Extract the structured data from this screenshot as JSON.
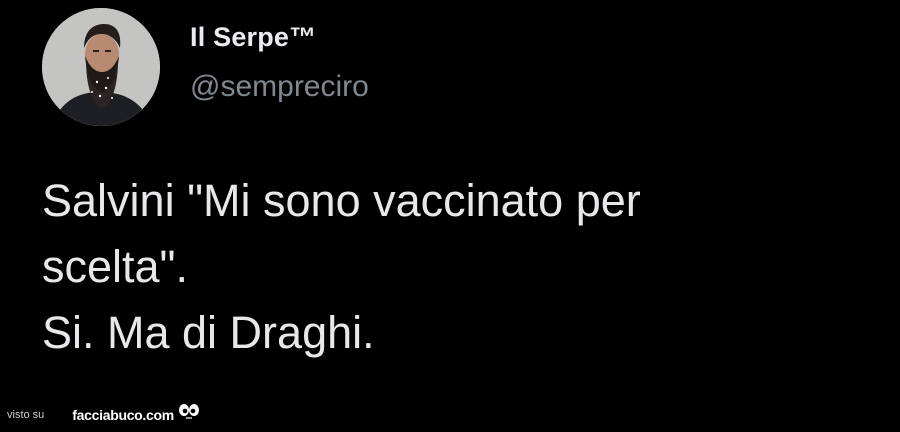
{
  "tweet": {
    "display_name": "Il Serpe™",
    "handle": "@sempreciro",
    "avatar_icon": "bearded-man-avatar",
    "lines": [
      "Salvini \"Mi sono vaccinato per",
      "scelta\".",
      "Si. Ma di Draghi."
    ]
  },
  "watermark": {
    "prefix": "visto su",
    "brand": "facciabuco.com",
    "logo_icon": "eyes-icon"
  },
  "colors": {
    "background": "#000000",
    "name": "#e9ecef",
    "handle": "#7f878f",
    "text": "#e6e8ea"
  }
}
